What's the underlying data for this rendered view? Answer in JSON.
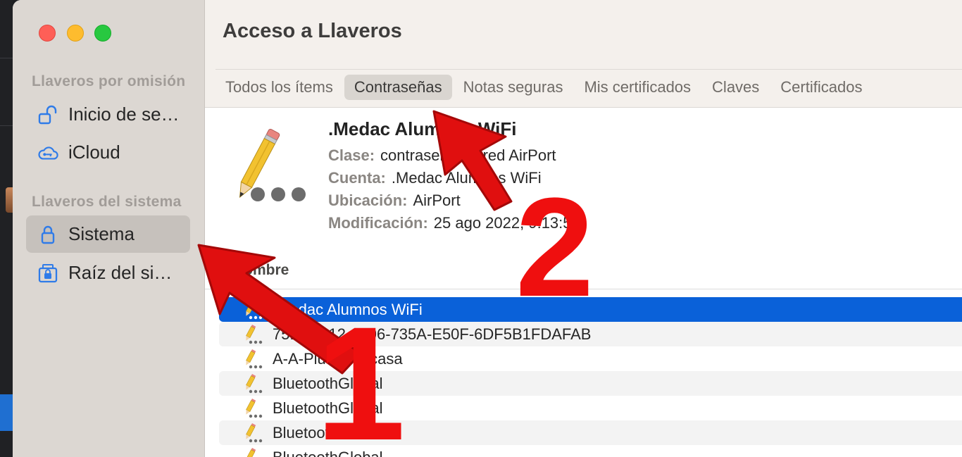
{
  "app": {
    "title": "Acceso a Llaveros"
  },
  "sidebar": {
    "sections": [
      {
        "heading": "Llaveros por omisión",
        "items": [
          {
            "label": "Inicio de se…",
            "icon": "unlocked-padlock-icon"
          },
          {
            "label": "iCloud",
            "icon": "cloud-lock-icon"
          }
        ]
      },
      {
        "heading": "Llaveros del sistema",
        "items": [
          {
            "label": "Sistema",
            "icon": "padlock-icon",
            "selected": true
          },
          {
            "label": "Raíz del sist…",
            "icon": "root-vault-icon"
          }
        ]
      }
    ]
  },
  "tabs": [
    {
      "label": "Todos los ítems",
      "active": false
    },
    {
      "label": "Contraseñas",
      "active": true
    },
    {
      "label": "Notas seguras",
      "active": false
    },
    {
      "label": "Mis certificados",
      "active": false
    },
    {
      "label": "Claves",
      "active": false
    },
    {
      "label": "Certificados",
      "active": false
    }
  ],
  "detail": {
    "icon": "pencil-password-icon",
    "name": ".Medac Alumnos WiFi",
    "fields": [
      {
        "label": "Clase:",
        "value": "contraseña de red AirPort"
      },
      {
        "label": "Cuenta:",
        "value": ".Medac Alumnos WiFi"
      },
      {
        "label": "Ubicación:",
        "value": "AirPort"
      },
      {
        "label": "Modificación:",
        "value": "25 ago 2022, 9:13:59"
      }
    ]
  },
  "list": {
    "column_header": "Nombre",
    "rows": [
      {
        "label": ".Medac Alumnos WiFi",
        "selected": true
      },
      {
        "label": "75EC0312-3806-735A-E50F-6DF5B1FDAFAB"
      },
      {
        "label": "A-A-Plus-Wifi-casa"
      },
      {
        "label": "BluetoothGlobal"
      },
      {
        "label": "BluetoothGlobal"
      },
      {
        "label": "BluetoothGlobal"
      },
      {
        "label": "BluetoothGlobal"
      }
    ]
  },
  "annotations": {
    "marker_1": "1",
    "marker_2": "2",
    "color": "#ef0f0f"
  },
  "colors": {
    "selection": "#0a61d9",
    "sidebar": "#dcd7d2",
    "titlebar": "#f4f0ec"
  }
}
